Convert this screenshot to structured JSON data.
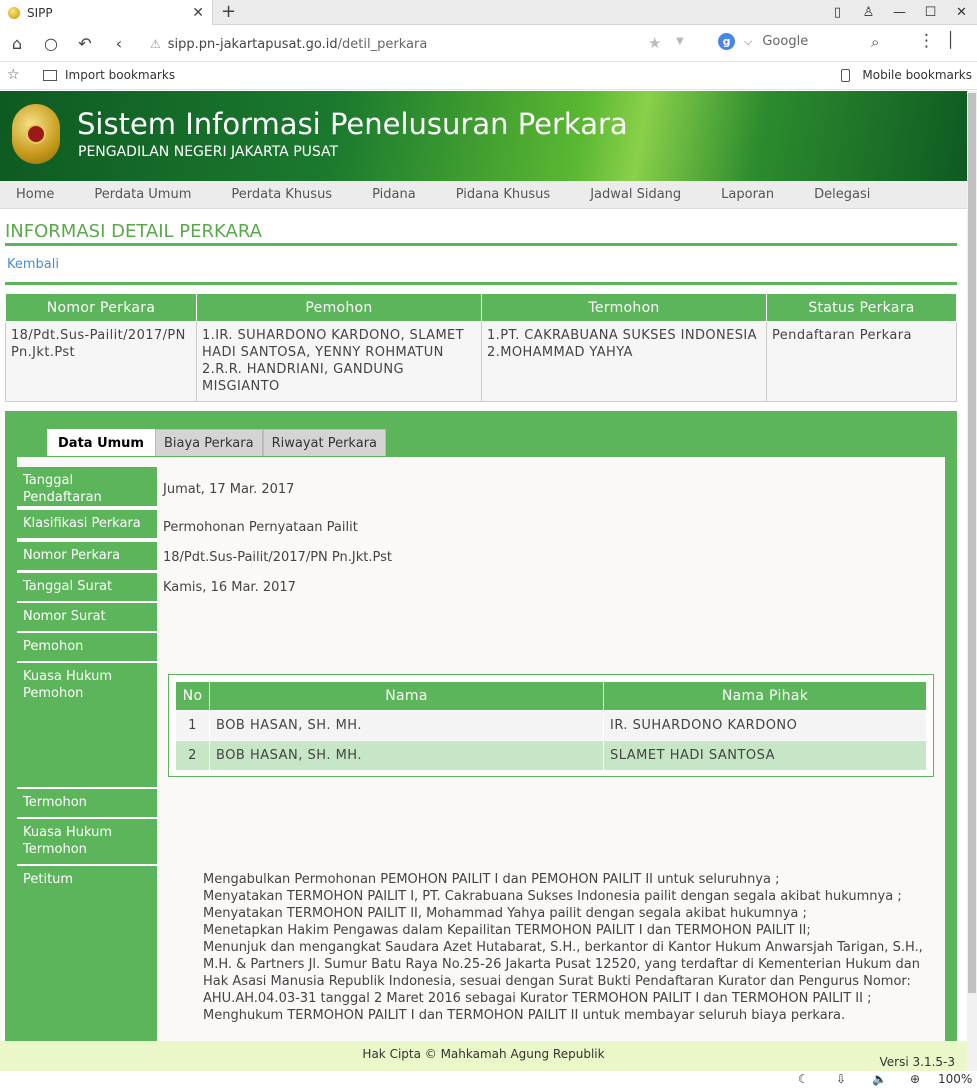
{
  "browser": {
    "tab_title": "SIPP",
    "close": "✕",
    "new_tab": "+",
    "url_host": "sipp.pn-jakartapusat.go.id",
    "url_path": "/detil_perkara",
    "search_engine": "Google",
    "bookmarks_import": "Import bookmarks",
    "bookmarks_mobile": "Mobile bookmarks",
    "zoom": "100%"
  },
  "header": {
    "title": "Sistem Informasi Penelusuran Perkara",
    "subtitle": "PENGADILAN NEGERI JAKARTA PUSAT"
  },
  "nav": [
    "Home",
    "Perdata Umum",
    "Perdata Khusus",
    "Pidana",
    "Pidana Khusus",
    "Jadwal Sidang",
    "Laporan",
    "Delegasi"
  ],
  "page_title": "INFORMASI DETAIL PERKARA",
  "back_link": "Kembali",
  "summary": {
    "headers": [
      "Nomor Perkara",
      "Pemohon",
      "Termohon",
      "Status Perkara"
    ],
    "nomor": "18/Pdt.Sus-Pailit/2017/PN Pn.Jkt.Pst",
    "pemohon_1": "1.IR. SUHARDONO KARDONO, SLAMET HADI SANTOSA, YENNY ROHMATUN",
    "pemohon_2": "2.R.R. HANDRIANI, GANDUNG MISGIANTO",
    "termohon_1": "1.PT. CAKRABUANA SUKSES INDONESIA",
    "termohon_2": "2.MOHAMMAD YAHYA",
    "status": "Pendaftaran Perkara"
  },
  "tabs": [
    "Data Umum",
    "Biaya Perkara",
    "Riwayat Perkara"
  ],
  "detail": {
    "tgl_daftar_label": "Tanggal Pendaftaran",
    "tgl_daftar": "Jumat, 17 Mar. 2017",
    "klasifikasi_label": "Klasifikasi Perkara",
    "klasifikasi": "Permohonan Pernyataan Pailit",
    "nomor_label": "Nomor Perkara",
    "nomor": "18/Pdt.Sus-Pailit/2017/PN Pn.Jkt.Pst",
    "tgl_surat_label": "Tanggal Surat",
    "tgl_surat": "Kamis, 16 Mar. 2017",
    "nomor_surat_label": "Nomor Surat",
    "pemohon_label": "Pemohon",
    "kuasa_pemohon_label": "Kuasa Hukum Pemohon",
    "termohon_label": "Termohon",
    "kuasa_termohon_label": "Kuasa Hukum Termohon",
    "petitum_label": "Petitum"
  },
  "kuasa_table": {
    "headers": [
      "No",
      "Nama",
      "Nama Pihak"
    ],
    "rows": [
      {
        "no": "1",
        "nama": "BOB HASAN, SH. MH.",
        "pihak": "IR. SUHARDONO KARDONO"
      },
      {
        "no": "2",
        "nama": "BOB HASAN, SH. MH.",
        "pihak": "SLAMET HADI SANTOSA"
      }
    ]
  },
  "petitum": [
    "Mengabulkan Permohonan PEMOHON PAILIT I dan PEMOHON PAILIT II untuk seluruhnya ;",
    "Menyatakan TERMOHON PAILIT I, PT. Cakrabuana Sukses Indonesia pailit dengan segala akibat hukumnya ;",
    "Menyatakan TERMOHON PAILIT  II, Mohammad Yahya pailit dengan segala akibat hukumnya ;",
    "Menetapkan Hakim Pengawas dalam Kepailitan TERMOHON PAILIT I dan TERMOHON PAILIT  II;",
    "Menunjuk dan mengangkat Saudara Azet Hutabarat, S.H., berkantor di Kantor Hukum Anwarsjah Tarigan, S.H., M.H. & Partners Jl. Sumur Batu Raya No.25-26 Jakarta Pusat 12520, yang terdaftar di Kementerian Hukum dan Hak Asasi Manusia Republik Indonesia, sesuai dengan Surat Bukti Pendaftaran Kurator dan Pengurus Nomor: AHU.AH.04.03-31 tanggal  2 Maret 2016 sebagai Kurator TERMOHON PAILIT I dan TERMOHON PAILIT  II ;",
    "Menghukum TERMOHON PAILIT  I dan TERMOHON PAILIT  II untuk membayar seluruh biaya perkara."
  ],
  "footer": {
    "copyright": "Hak Cipta © Mahkamah Agung Republik",
    "version": "Versi 3.1.5-3"
  },
  "colors": {
    "accent": "#5cb55a",
    "header_dark": "#0e5a22",
    "link": "#4a8ad8",
    "footer": "#eaf7c9"
  }
}
